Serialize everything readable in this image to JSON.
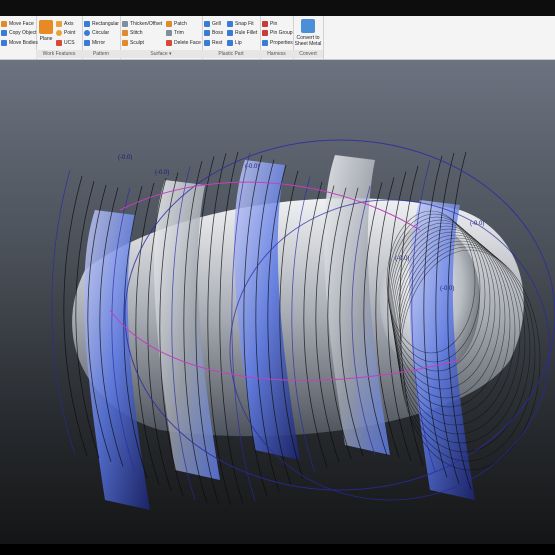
{
  "titlebar": {
    "text": ""
  },
  "ribbon": {
    "panels": {
      "modify": {
        "items": [
          "Move Face",
          "Copy Object",
          "Move Bodies"
        ]
      },
      "work_features": {
        "title": "Work Features",
        "plane": "Plane",
        "items": [
          "Axis",
          "Point",
          "UCS"
        ]
      },
      "pattern": {
        "title": "Pattern",
        "items": [
          "Rectangular",
          "Circular",
          "Mirror"
        ]
      },
      "surface": {
        "title": "Surface",
        "col1": [
          "Thicken/Offset",
          "Stitch",
          "Sculpt"
        ],
        "col2": [
          "Patch",
          "Trim",
          "Delete Face"
        ]
      },
      "plastic_part": {
        "title": "Plastic Part",
        "col1": [
          "Grill",
          "Boss",
          "Rest"
        ],
        "col2": [
          "Snap Fit",
          "Rule Fillet",
          "Lip"
        ]
      },
      "harness": {
        "title": "Harness",
        "items": [
          "Pin",
          "Pin Group",
          "Properties"
        ]
      },
      "convert": {
        "title": "Convert",
        "big_label_1": "Convert to",
        "big_label_2": "Sheet Metal"
      }
    }
  },
  "viewport": {
    "colors": {
      "surface_light": "#e2e4e8",
      "surface_dark": "#3a3f47",
      "blue_light": "#5a78e6",
      "curve_blue": "#2a2aa0",
      "curve_black": "#0a0a0a",
      "magenta": "#c040c0"
    },
    "annotations": [
      {
        "id": "ann1",
        "text": "(-0.0)"
      },
      {
        "id": "ann2",
        "text": "(-0.0)"
      },
      {
        "id": "ann3",
        "text": "(-0.0)"
      },
      {
        "id": "ann4",
        "text": "(-0.0)"
      },
      {
        "id": "ann5",
        "text": "(-0.0)"
      },
      {
        "id": "ann6",
        "text": "(-0.0)"
      }
    ]
  }
}
